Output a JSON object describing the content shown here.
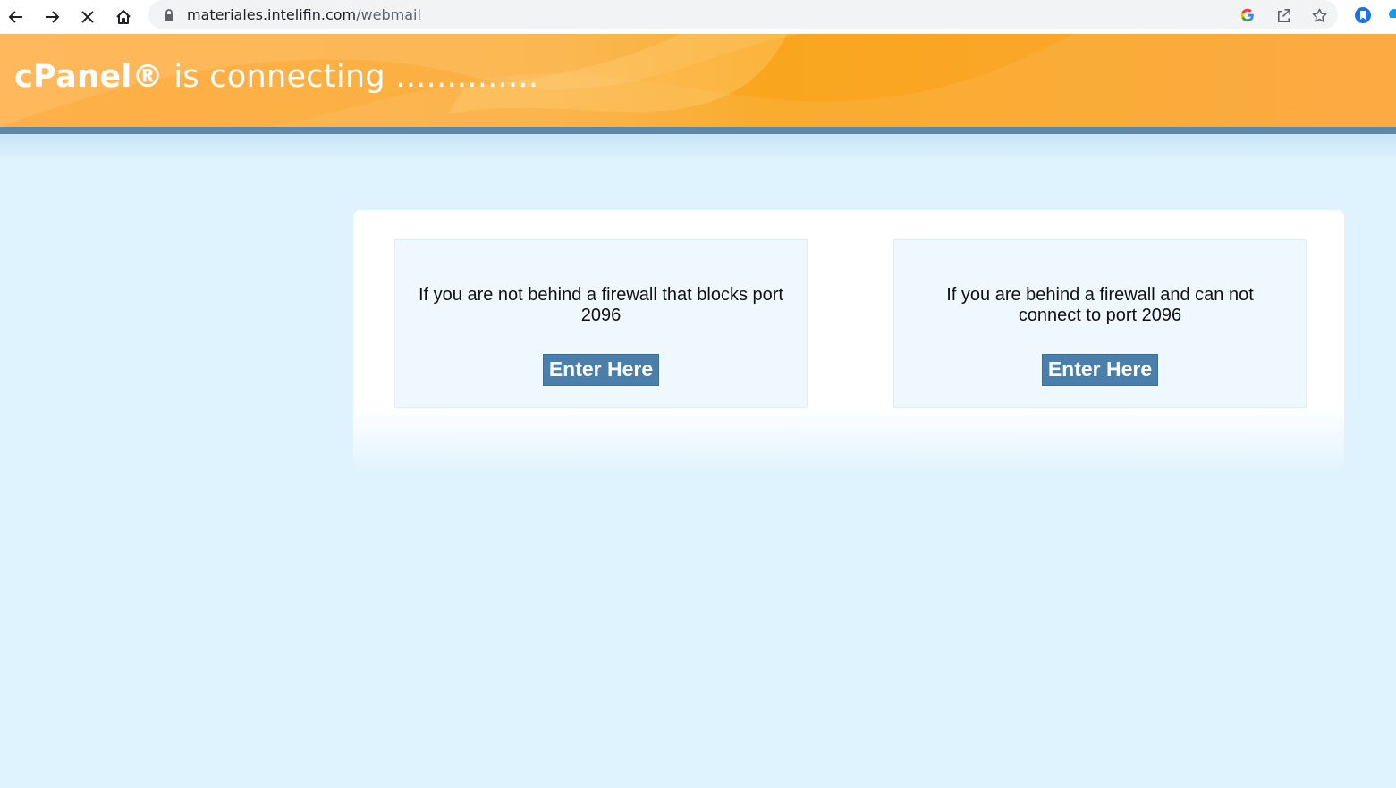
{
  "browser": {
    "url_host": "materiales.intelifin.com",
    "url_path": "/webmail",
    "icons": [
      "back-arrow-icon",
      "forward-arrow-icon",
      "stop-loading-icon",
      "home-icon",
      "lock-icon",
      "google-icon",
      "share-icon",
      "bookmark-star-icon",
      "extension-icon"
    ]
  },
  "header": {
    "brand": "cPanel®",
    "title_rest": " is connecting ..............",
    "colors": {
      "banner": "#fbb03f",
      "stripe": "#5b87aa"
    }
  },
  "options": [
    {
      "text": "If you are not behind a firewall that blocks port 2096",
      "button": "Enter Here"
    },
    {
      "text": "If you are behind a firewall and can not connect to port 2096",
      "button": "Enter Here"
    }
  ],
  "colors": {
    "page_bg": "#dff3fe",
    "button_bg": "#4a7fac"
  }
}
